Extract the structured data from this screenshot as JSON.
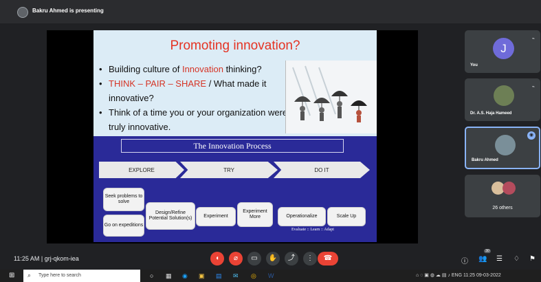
{
  "meeting": {
    "presenter_label": "Bakru Ahmed is presenting",
    "time_code": "11:25 AM  |  grj-qkom-iea"
  },
  "slide": {
    "title": "Promoting innovation?",
    "bullets": [
      {
        "before": "Building culture of ",
        "highlight": "Innovation",
        "after": " thinking?"
      },
      {
        "red_text": "THINK – PAIR – SHARE",
        "after": " / What made it innovative?"
      },
      {
        "text": "Think of a time you or your organization were truly innovative."
      }
    ],
    "process_title": "The Innovation Process",
    "arrows": [
      "EXPLORE",
      "TRY",
      "DO IT"
    ],
    "boxes": [
      "Seek problems to solve",
      "Go on expeditions",
      "Design/Refine Potential Solution(s)",
      "Experiment",
      "Experiment More",
      "Operationalize",
      "Scale Up"
    ],
    "cycle_text": "Evaluate :: Learn :: Adapt"
  },
  "participants": [
    {
      "name": "You",
      "initial": "J"
    },
    {
      "name": "Dr. A.S. Haja Hameed"
    },
    {
      "name": "Bakru Ahmed"
    },
    {
      "name": "26 others"
    }
  ],
  "controls": {
    "people_count": "30"
  },
  "taskbar": {
    "search_placeholder": "Type here to search",
    "tray_text": "ENG",
    "clock": "11:25",
    "date": "09-03-2022"
  }
}
